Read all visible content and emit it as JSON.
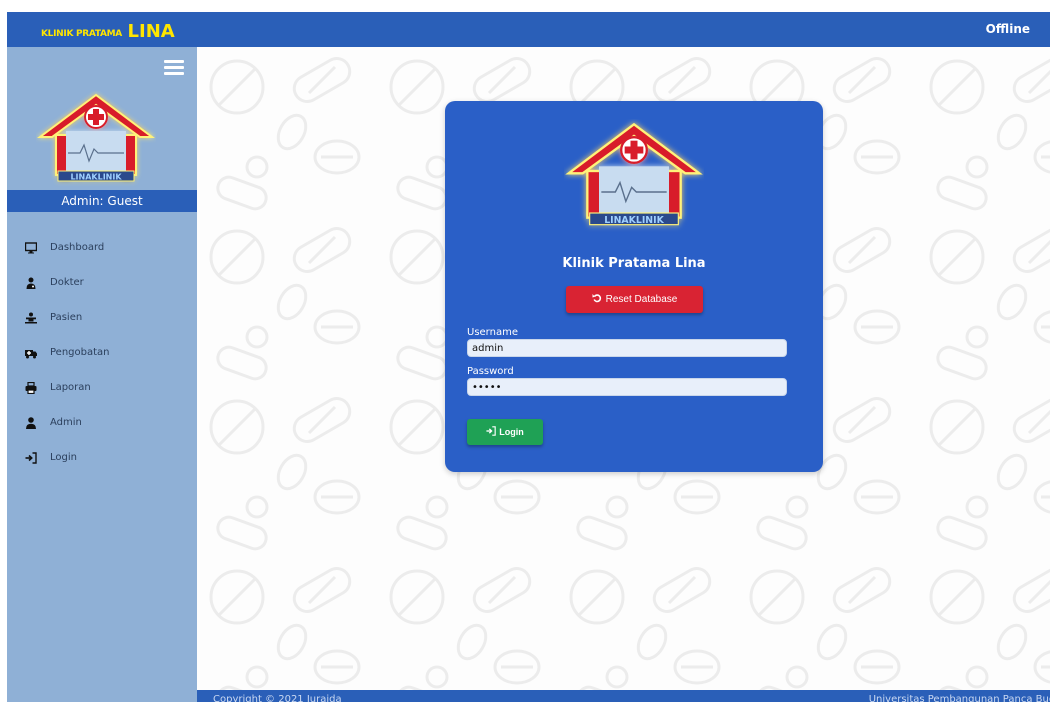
{
  "header": {
    "brand_small": "KLINIK PRATAMA",
    "brand_big": "LINA",
    "status": "Offline"
  },
  "sidebar": {
    "user_label": "Admin: Guest",
    "items": [
      {
        "label": "Dashboard",
        "icon": "monitor-icon"
      },
      {
        "label": "Dokter",
        "icon": "doctor-icon"
      },
      {
        "label": "Pasien",
        "icon": "patient-icon"
      },
      {
        "label": "Pengobatan",
        "icon": "treatment-icon"
      },
      {
        "label": "Laporan",
        "icon": "print-icon"
      },
      {
        "label": "Admin",
        "icon": "user-icon"
      },
      {
        "label": "Login",
        "icon": "sign-in-icon"
      }
    ]
  },
  "login": {
    "title": "Klinik Pratama Lina",
    "reset_label": "Reset Database",
    "username_label": "Username",
    "username_value": "admin",
    "password_label": "Password",
    "password_value": "•••••",
    "login_label": "Login"
  },
  "footer": {
    "left": "Copyright © 2021 Juraida",
    "right": "Universitas Pembangunan Panca Budi"
  },
  "colors": {
    "primary": "#2a5fb8",
    "sidebar": "#8fb0d6",
    "danger": "#d92333",
    "success": "#1fa155",
    "brand_yellow": "#ffe600"
  }
}
